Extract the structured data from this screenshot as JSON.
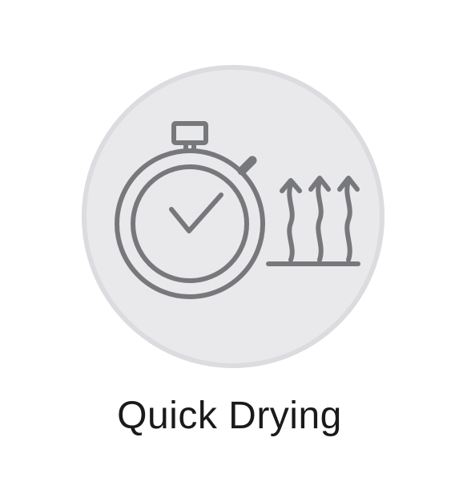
{
  "feature": {
    "label": "Quick Drying",
    "icon": "quick-drying-icon",
    "colors": {
      "badge_fill": "#e9e9ec",
      "badge_ring": "#dcdce0",
      "icon_stroke": "#77787b",
      "label_text": "#1a1a1a"
    }
  }
}
